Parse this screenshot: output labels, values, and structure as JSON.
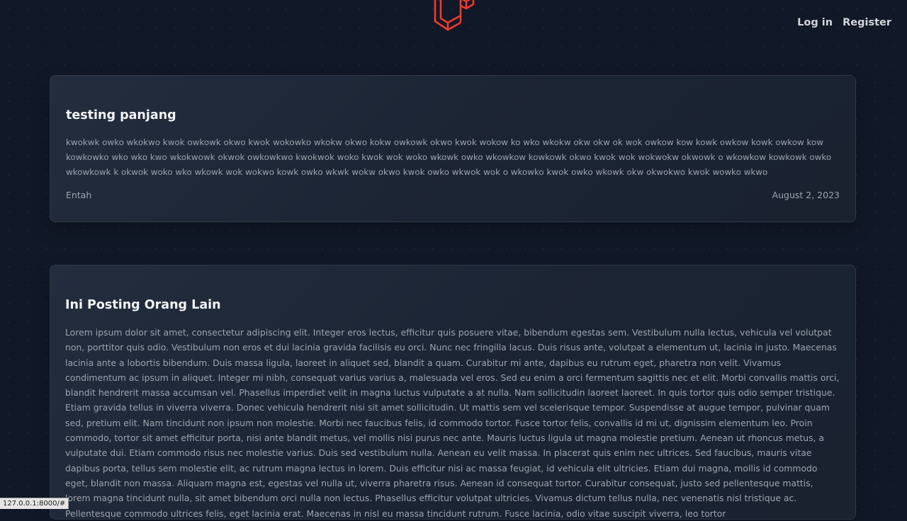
{
  "brand": {
    "logo_icon": "laravel-logo-icon",
    "color": "#ef3b2d"
  },
  "nav": {
    "login_label": "Log in",
    "register_label": "Register"
  },
  "posts": [
    {
      "title": "testing panjang",
      "body": "kwokwk owko wkokwo kwok owkowk okwo kwok wokowko wkokw okwo kokw owkowk okwo kwok wokow ko wko wkokw okw okw ok wok owkow kow kowk owkow kowk owkow kow kowkowko wko wko kwo wkokwowk okwok owkowkwo kwokwok woko kwok wok woko wkowk owko wkowkow kowkowk okwo kwok wok wokwokw okwowk o wkowkow kowkowk owko wkowkowk k okwok woko wko wkowk wok wokwo kowk owko wkwk wokw okwo kwok owko wkwok wok o wkowko kwok owko wkowk okw okwokwo kwok wowko wkwo",
      "author": "Entah",
      "date": "August 2, 2023"
    },
    {
      "title": "Ini Posting Orang Lain",
      "body": "Lorem ipsum dolor sit amet, consectetur adipiscing elit. Integer eros lectus, efficitur quis posuere vitae, bibendum egestas sem. Vestibulum nulla lectus, vehicula vel volutpat non, porttitor quis odio. Vestibulum non eros et dui lacinia gravida facilisis eu orci. Nunc nec fringilla lacus. Duis risus ante, volutpat a elementum ut, lacinia in justo. Maecenas lacinia ante a lobortis bibendum. Duis massa ligula, laoreet in aliquet sed, blandit a quam. Curabitur mi ante, dapibus eu rutrum eget, pharetra non velit. Vivamus condimentum ac ipsum in aliquet. Integer mi nibh, consequat varius varius a, malesuada vel eros. Sed eu enim a orci fermentum sagittis nec et elit. Morbi convallis mattis orci, blandit hendrerit massa accumsan vel. Phasellus imperdiet velit in magna luctus vulputate a at nulla. Nam sollicitudin laoreet laoreet. In quis tortor quis odio semper tristique. Etiam gravida tellus in viverra viverra. Donec vehicula hendrerit nisi sit amet sollicitudin. Ut mattis sem vel scelerisque tempor. Suspendisse at augue tempor, pulvinar quam sed, pretium elit. Nam tincidunt non ipsum non molestie. Morbi nec faucibus felis, id commodo tortor. Fusce tortor felis, convallis id mi ut, dignissim elementum leo. Proin commodo, tortor sit amet efficitur porta, nisi ante blandit metus, vel mollis nisi purus nec ante. Mauris luctus ligula ut magna molestie pretium. Aenean ut rhoncus metus, a vulputate dui. Etiam commodo risus nec molestie varius. Duis sed vestibulum nulla. Aenean eu velit massa. In placerat quis enim nec ultrices. Sed faucibus, mauris vitae dapibus porta, tellus sem molestie elit, ac rutrum magna lectus in lorem. Duis efficitur nisi ac massa feugiat, id vehicula elit ultricies. Etiam dui magna, mollis id commodo eget, blandit non massa. Aliquam magna est, egestas vel nulla ut, viverra pharetra risus. Aenean id consequat tortor. Curabitur consequat, justo sed pellentesque mattis, lorem magna tincidunt nulla, sit amet bibendum orci nulla non lectus. Phasellus efficitur volutpat ultricies. Vivamus dictum tellus nulla, nec venenatis nisl tristique ac. Pellentesque commodo ultrices felis, eget lacinia erat. Maecenas in nisl eu massa tincidunt rutrum. Fusce lacinia, odio vitae suscipit viverra, leo tortor"
    }
  ],
  "status_bar": {
    "url": "127.0.0.1:8000/#"
  }
}
